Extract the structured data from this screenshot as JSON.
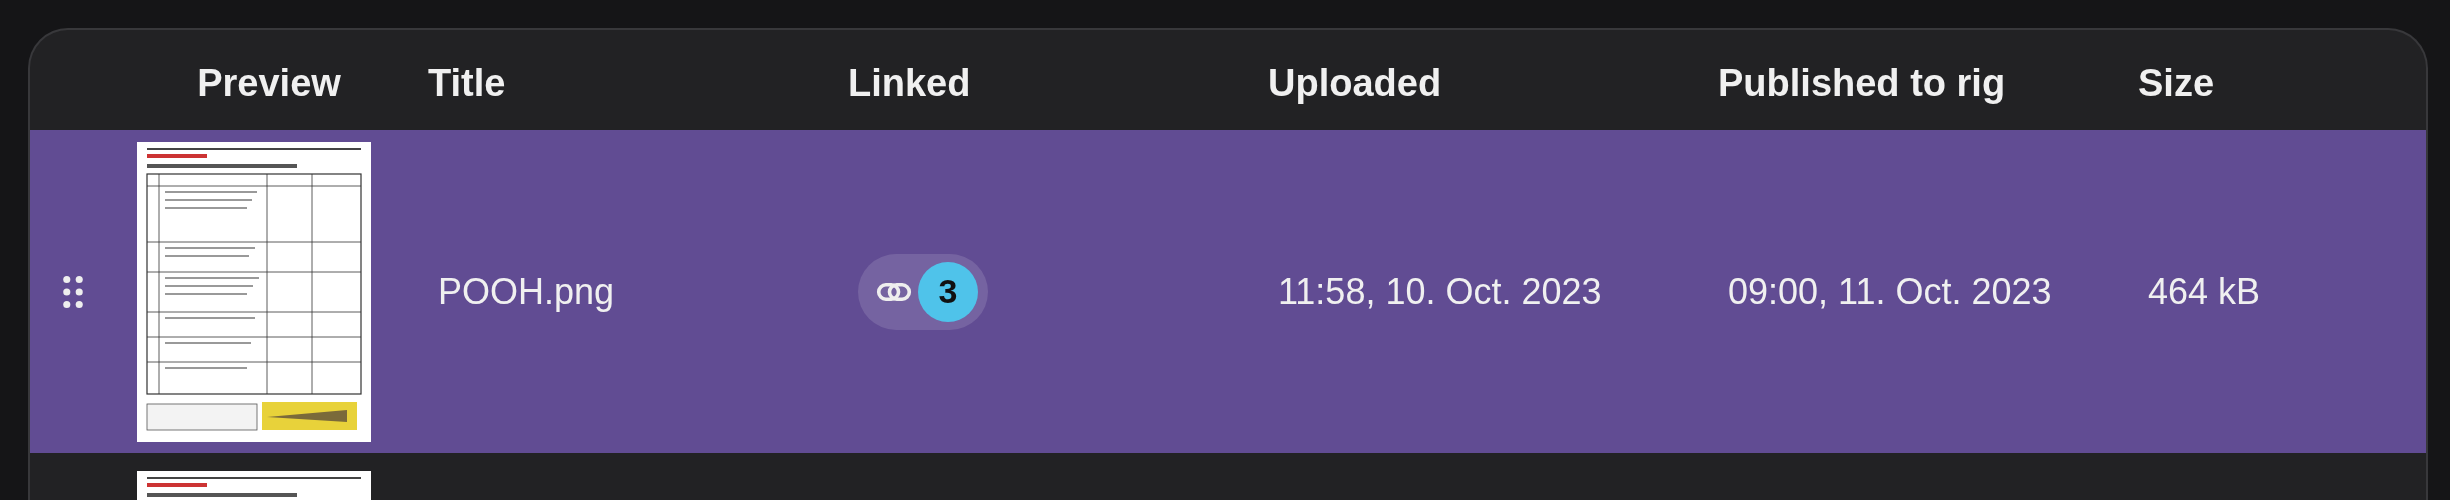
{
  "table": {
    "columns": [
      "Preview",
      "Title",
      "Linked",
      "Uploaded",
      "Published to rig",
      "Size"
    ],
    "rows": [
      {
        "selected": true,
        "title": "POOH.png",
        "linked": "3",
        "uploaded": "11:58, 10. Oct. 2023",
        "published": "09:00, 11. Oct. 2023",
        "size": "464 kB"
      },
      {
        "selected": false
      }
    ]
  }
}
